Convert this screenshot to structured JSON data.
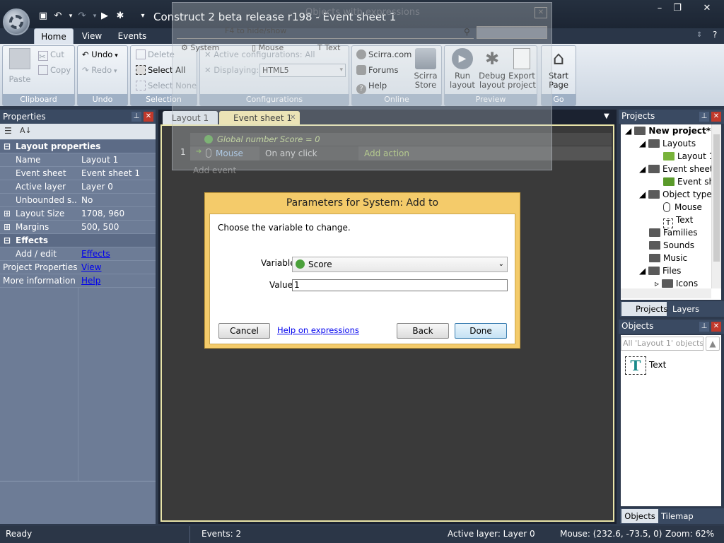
{
  "window": {
    "title": "Construct 2 beta release r198 - Event sheet 1",
    "controls": [
      "–",
      "❐",
      "✕"
    ]
  },
  "ribbon_tabs": [
    "Home",
    "View",
    "Events"
  ],
  "clipboard": {
    "paste": "Paste",
    "cut": "Cut",
    "copy": "Copy",
    "label": "Clipboard"
  },
  "undo": {
    "undo": "Undo",
    "redo": "Redo",
    "label": "Undo"
  },
  "selection": {
    "delete": "Delete",
    "select_all": "Select All",
    "select_none": "Select None",
    "label": "Selection"
  },
  "configurations": {
    "active": "Active configurations: All",
    "displaying": "Displaying:",
    "platform": "HTML5",
    "label": "Configurations"
  },
  "online": {
    "scirra": "Scirra.com",
    "forums": "Forums",
    "help": "Help",
    "store_l1": "Scirra",
    "store_l2": "Store",
    "label": "Online"
  },
  "preview": {
    "run_l1": "Run",
    "run_l2": "layout",
    "debug_l1": "Debug",
    "debug_l2": "layout",
    "export_l1": "Export",
    "export_l2": "project",
    "label": "Preview"
  },
  "go": {
    "start_l1": "Start",
    "start_l2": "Page",
    "label": "Go"
  },
  "floating": {
    "title": "Objects with expressions",
    "hint": "F4 to hide/show",
    "items": [
      "System",
      "Mouse",
      "Text"
    ]
  },
  "properties": {
    "title": "Properties",
    "section_layout": "Layout properties",
    "rows": [
      {
        "k": "Name",
        "v": "Layout 1"
      },
      {
        "k": "Event sheet",
        "v": "Event sheet 1"
      },
      {
        "k": "Active layer",
        "v": "Layer 0"
      },
      {
        "k": "Unbounded s...",
        "v": "No"
      },
      {
        "k": "Layout Size",
        "v": "1708, 960"
      },
      {
        "k": "Margins",
        "v": "500, 500"
      }
    ],
    "section_effects": "Effects",
    "add_edit": "Add / edit",
    "effects_link": "Effects",
    "project_properties": "Project Properties",
    "view_link": "View",
    "more_info": "More information",
    "help_link": "Help"
  },
  "editor_tabs": [
    "Layout 1",
    "Event sheet 1"
  ],
  "events": {
    "global_var": "Global number  Score = 0",
    "row_num": "1",
    "object": "Mouse",
    "condition": "On any click",
    "add_action": "Add action",
    "add_event": "Add event"
  },
  "projects": {
    "title": "Projects",
    "items": [
      "New project*",
      "Layouts",
      "Layout 1",
      "Event sheets",
      "Event sh",
      "Object types",
      "Mouse",
      "Text",
      "Families",
      "Sounds",
      "Music",
      "Files",
      "Icons"
    ],
    "tabs": [
      "Projects",
      "Layers"
    ]
  },
  "objects": {
    "title": "Objects",
    "filter": "All 'Layout 1' objects",
    "item": "Text",
    "tabs": [
      "Objects",
      "Tilemap"
    ]
  },
  "dialog": {
    "title": "Parameters for System: Add to",
    "prompt": "Choose the variable to change.",
    "variable_label": "Variable",
    "variable_value": "Score",
    "value_label": "Value",
    "value_value": "1",
    "cancel": "Cancel",
    "help": "Help on expressions",
    "back": "Back",
    "done": "Done"
  },
  "status": {
    "ready": "Ready",
    "events": "Events: 2",
    "active_layer": "Active layer: Layer 0",
    "mouse": "Mouse: (232.6, -73.5, 0)",
    "zoom": "Zoom: 62%"
  }
}
